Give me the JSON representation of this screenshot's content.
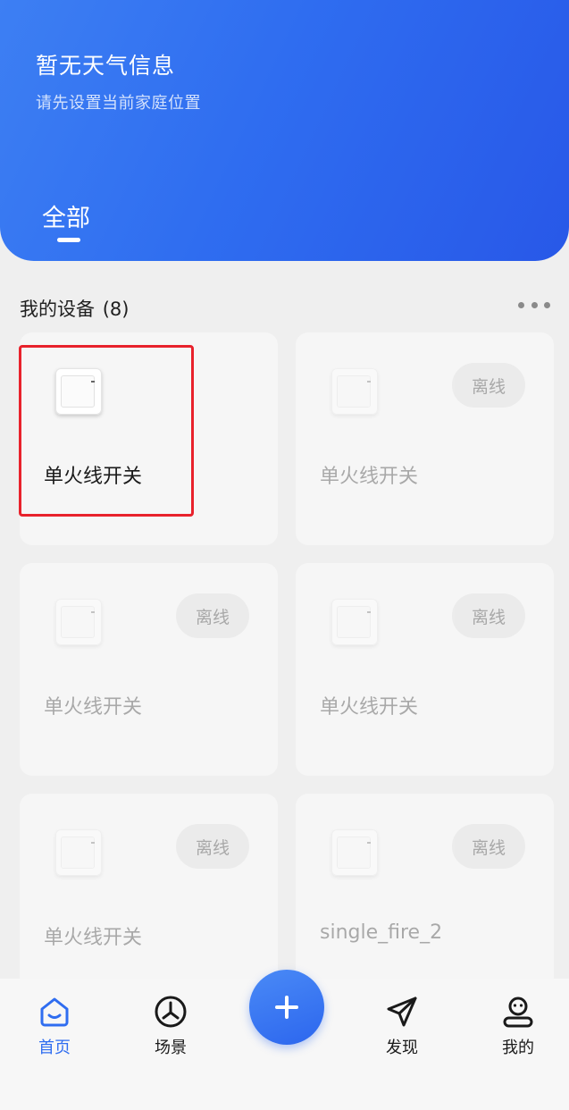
{
  "header": {
    "weather_title": "暂无天气信息",
    "weather_subtitle": "请先设置当前家庭位置",
    "tab_all": "全部"
  },
  "devices_section": {
    "title": "我的设备",
    "count": "(8)"
  },
  "devices": [
    {
      "name": "单火线开关",
      "status": "",
      "offline": false
    },
    {
      "name": "单火线开关",
      "status": "离线",
      "offline": true
    },
    {
      "name": "单火线开关",
      "status": "离线",
      "offline": true
    },
    {
      "name": "单火线开关",
      "status": "离线",
      "offline": true
    },
    {
      "name": "单火线开关",
      "status": "离线",
      "offline": true
    },
    {
      "name": "single_fire_2",
      "status": "离线",
      "offline": true
    }
  ],
  "bottom_nav": {
    "home": "首页",
    "scene": "场景",
    "discover": "发现",
    "mine": "我的"
  },
  "colors": {
    "accent": "#2f6df0",
    "highlight": "#e8222c"
  }
}
